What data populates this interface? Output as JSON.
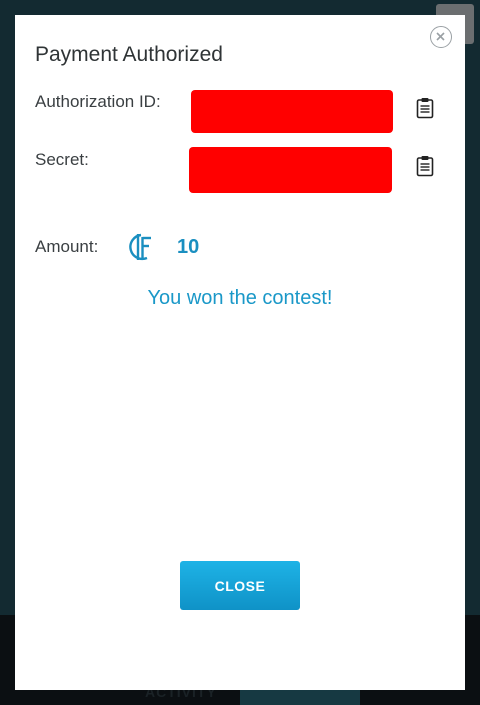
{
  "background": {
    "tab_label": "ACTIVITY"
  },
  "modal": {
    "title": "Payment Authorized",
    "authorization_label": "Authorization ID:",
    "secret_label": "Secret:",
    "amount_label": "Amount:",
    "amount_value": "10",
    "message": "You won the contest!",
    "close_button": "CLOSE",
    "icons": {
      "close": "close-circle-icon",
      "copy": "clipboard-icon",
      "currency": "coin-icon"
    },
    "colors": {
      "accent": "#1a98c8",
      "redaction": "#ff0000",
      "button": "#1aa6dc"
    }
  }
}
